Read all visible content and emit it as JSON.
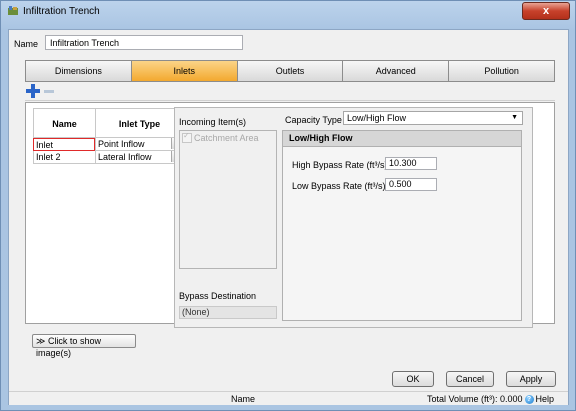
{
  "window": {
    "title": "Infiltration Trench",
    "close_glyph": "x"
  },
  "name_field": {
    "label": "Name",
    "value": "Infiltration Trench"
  },
  "tabs": [
    {
      "label": "Dimensions",
      "active": false
    },
    {
      "label": "Inlets",
      "active": true
    },
    {
      "label": "Outlets",
      "active": false
    },
    {
      "label": "Advanced",
      "active": false
    },
    {
      "label": "Pollution",
      "active": false
    }
  ],
  "inlet_grid": {
    "headers": [
      "Name",
      "Inlet Type"
    ],
    "rows": [
      {
        "name": "Inlet",
        "type": "Point Inflow",
        "selected": true
      },
      {
        "name": "Inlet 2",
        "type": "Lateral Inflow",
        "selected": false
      }
    ]
  },
  "inlet_panel": {
    "incoming_label": "Incoming Item(s)",
    "incoming_items": [
      "Catchment Area"
    ],
    "bypass_label": "Bypass Destination",
    "bypass_value": "(None)",
    "capacity_label": "Capacity Type",
    "capacity_value": "Low/High Flow",
    "group_title": "Low/High Flow",
    "high_label": "High Bypass Rate (ft³/s)",
    "high_value": "10.300",
    "low_label": "Low Bypass Rate (ft³/s)",
    "low_value": "0.500"
  },
  "show_images_label": "Click to show image(s)",
  "buttons": {
    "ok": "OK",
    "cancel": "Cancel",
    "apply": "Apply"
  },
  "status": {
    "name": "Name",
    "total_volume": "Total Volume (ft³): 0.000",
    "help": "Help"
  },
  "icons": {
    "add": "plus-icon",
    "remove": "minus-icon",
    "help": "help-icon",
    "app": "app-icon"
  },
  "colors": {
    "active_tab": "#f3a92f",
    "selected_cell_border": "#e02a2a",
    "add_icon": "#2a64c8"
  }
}
